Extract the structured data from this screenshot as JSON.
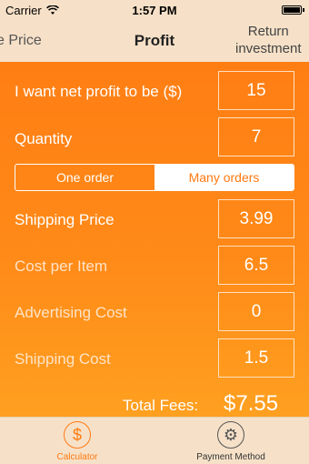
{
  "status_bar": {
    "carrier": "Carrier",
    "time": "1:57 PM",
    "wifi_icon": "wifi-icon",
    "battery_icon": "battery-icon"
  },
  "nav": {
    "left_tab": "e Price",
    "title": "Profit",
    "right_tab_line1": "Return",
    "right_tab_line2": "investment"
  },
  "form": {
    "target_profit": {
      "label": "I want net profit to be ($)",
      "value": "15"
    },
    "quantity": {
      "label": "Quantity",
      "value": "7"
    },
    "order_mode": {
      "options": [
        "One order",
        "Many orders"
      ],
      "selected": "Many orders"
    },
    "shipping_price": {
      "label": "Shipping Price",
      "value": "3.99"
    },
    "cost_per_item": {
      "label": "Cost per Item",
      "value": "6.5"
    },
    "advertising_cost": {
      "label": "Advertising Cost",
      "value": "0"
    },
    "shipping_cost": {
      "label": "Shipping Cost",
      "value": "1.5"
    }
  },
  "totals": {
    "label": "Total Fees:",
    "value": "$7.55"
  },
  "tabbar": {
    "items": [
      {
        "label": "Calculator",
        "icon": "dollar-icon",
        "active": true,
        "glyph": "$"
      },
      {
        "label": "Payment Method",
        "icon": "gear-icon",
        "active": false,
        "glyph": "⚙"
      }
    ]
  },
  "colors": {
    "accent": "#ff7a12",
    "bar_background": "#f6e1c8",
    "content_top": "#ff7e14",
    "content_bottom": "#ffa020"
  }
}
